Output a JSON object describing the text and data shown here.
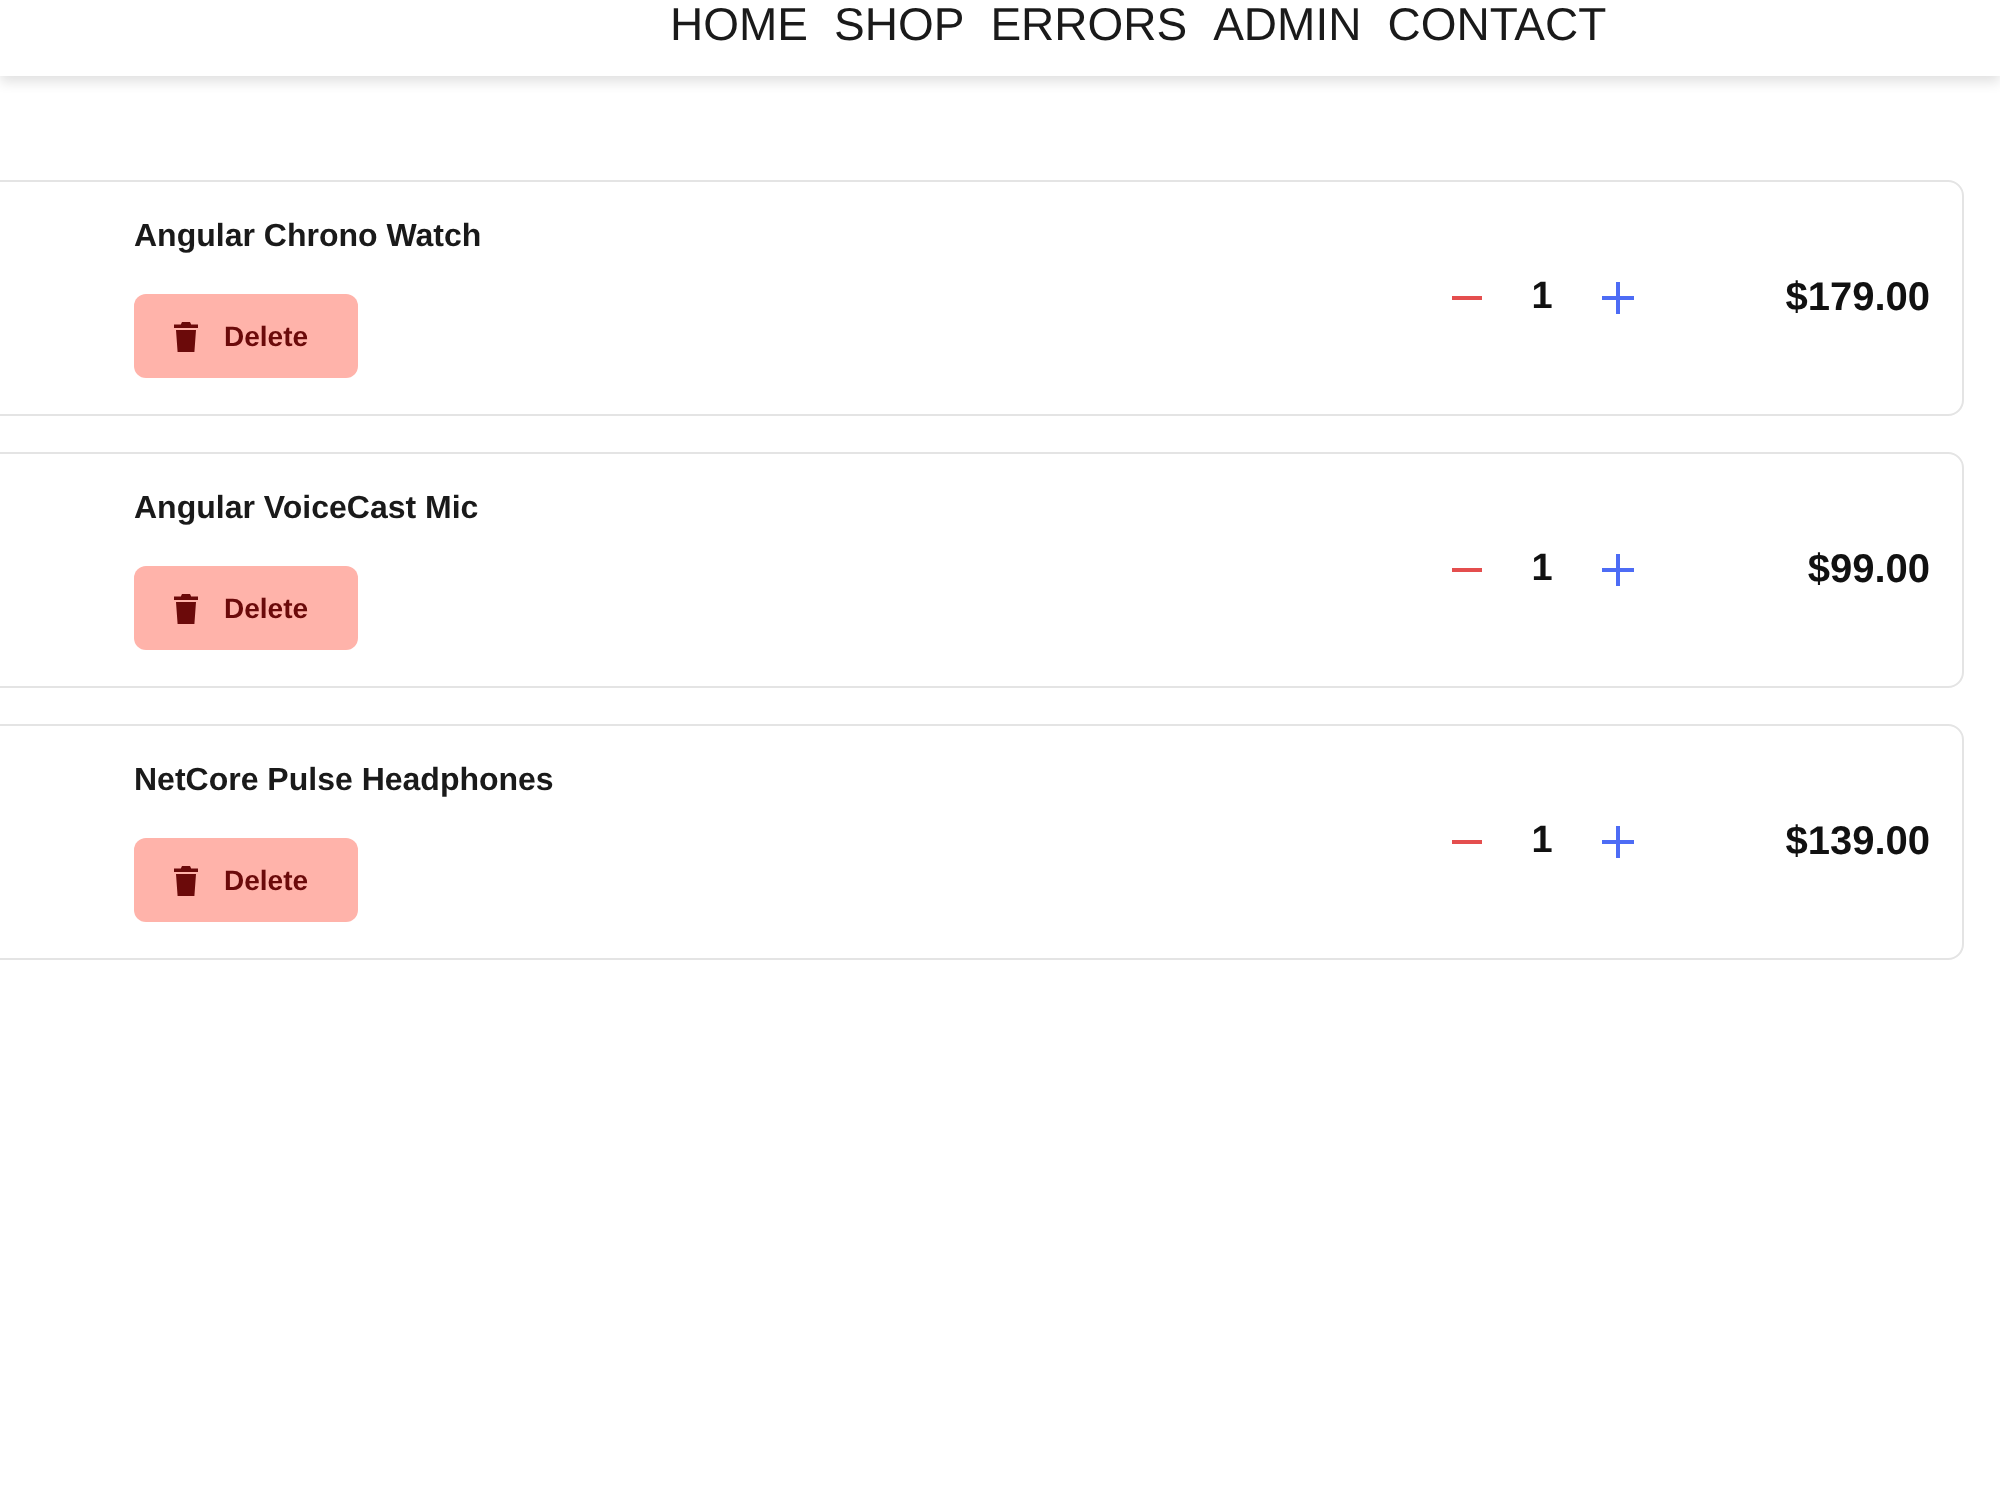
{
  "nav": {
    "items": [
      {
        "label": "HOME"
      },
      {
        "label": "SHOP"
      },
      {
        "label": "ERRORS"
      },
      {
        "label": "ADMIN"
      },
      {
        "label": "CONTACT"
      }
    ]
  },
  "cart": {
    "items": [
      {
        "name": "Angular Chrono Watch",
        "delete_label": "Delete",
        "quantity": "1",
        "price": "$179.00"
      },
      {
        "name": "Angular VoiceCast Mic",
        "delete_label": "Delete",
        "quantity": "1",
        "price": "$99.00"
      },
      {
        "name": "NetCore Pulse Headphones",
        "delete_label": "Delete",
        "quantity": "1",
        "price": "$139.00"
      }
    ]
  }
}
